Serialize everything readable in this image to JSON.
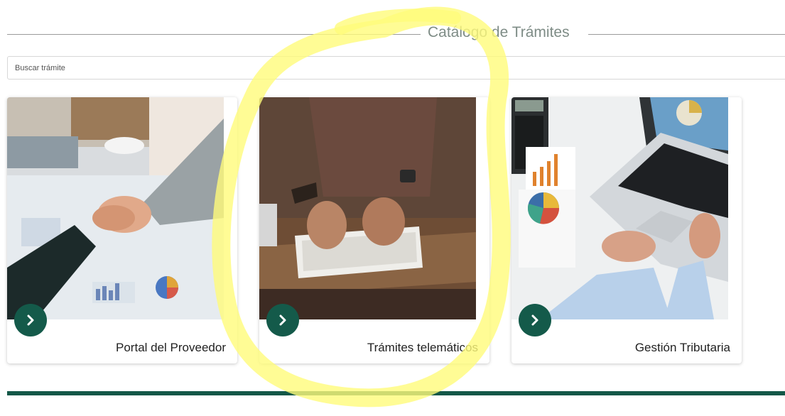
{
  "header": {
    "title": "Catálogo de Trámites"
  },
  "search": {
    "placeholder": "Buscar trámite",
    "value": ""
  },
  "cards": [
    {
      "label": "Portal del Proveedor",
      "icon": "chevron-right-icon"
    },
    {
      "label": "Trámites telemáticos",
      "icon": "chevron-right-icon"
    },
    {
      "label": "Gestión Tributaria",
      "icon": "chevron-right-icon"
    }
  ],
  "colors": {
    "accent": "#145a4a",
    "footer_bar": "#135848",
    "title_text": "#7e8c86",
    "highlight": "#fffb7a"
  }
}
